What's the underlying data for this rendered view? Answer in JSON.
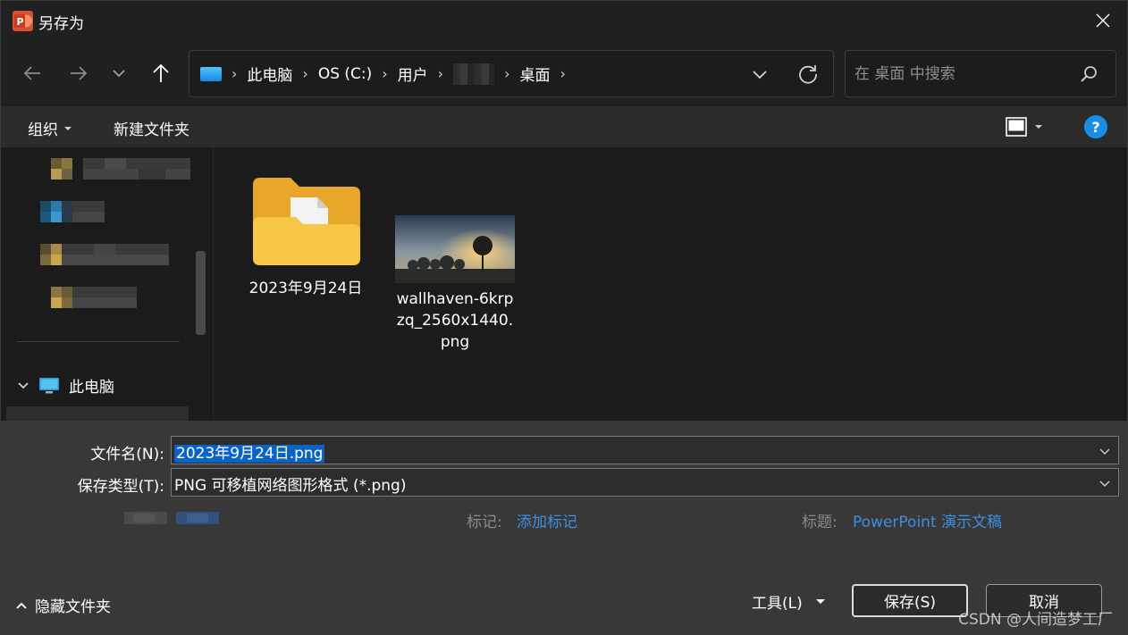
{
  "window": {
    "title": "另存为",
    "app_icon": "powerpoint-icon"
  },
  "nav": {
    "back_icon": "arrow-left-icon",
    "forward_icon": "arrow-right-icon",
    "recent_icon": "chevron-down-icon",
    "up_icon": "arrow-up-icon",
    "breadcrumbs": [
      "此电脑",
      "OS (C:)",
      "用户",
      "桌面"
    ],
    "refresh_icon": "refresh-icon"
  },
  "search": {
    "placeholder": "在 桌面 中搜索"
  },
  "toolbar": {
    "organize_label": "组织",
    "new_folder_label": "新建文件夹",
    "help_label": "?"
  },
  "navpane": {
    "this_pc_label": "此电脑"
  },
  "files": [
    {
      "name": "2023年9月24日",
      "type": "folder"
    },
    {
      "name_lines": [
        "wallhaven-6krp",
        "zq_2560x1440.",
        "png"
      ],
      "type": "image"
    }
  ],
  "form": {
    "filename_label": "文件名(N):",
    "filename_value": "2023年9月24日.png",
    "filetype_label": "保存类型(T):",
    "filetype_value": "PNG 可移植网络图形格式 (*.png)",
    "tags_label": "标记:",
    "tags_link": "添加标记",
    "title_label": "标题:",
    "title_link": "PowerPoint 演示文稿"
  },
  "footer": {
    "hide_folders_label": "隐藏文件夹",
    "tools_label": "工具(L)",
    "save_label": "保存(S)",
    "cancel_label": "取消",
    "watermark": "CSDN @人间造梦工厂"
  },
  "colors": {
    "accent": "#1a8ee6",
    "link": "#3a8fe0",
    "selection": "#0a64c8",
    "folder": "#f6c644"
  }
}
